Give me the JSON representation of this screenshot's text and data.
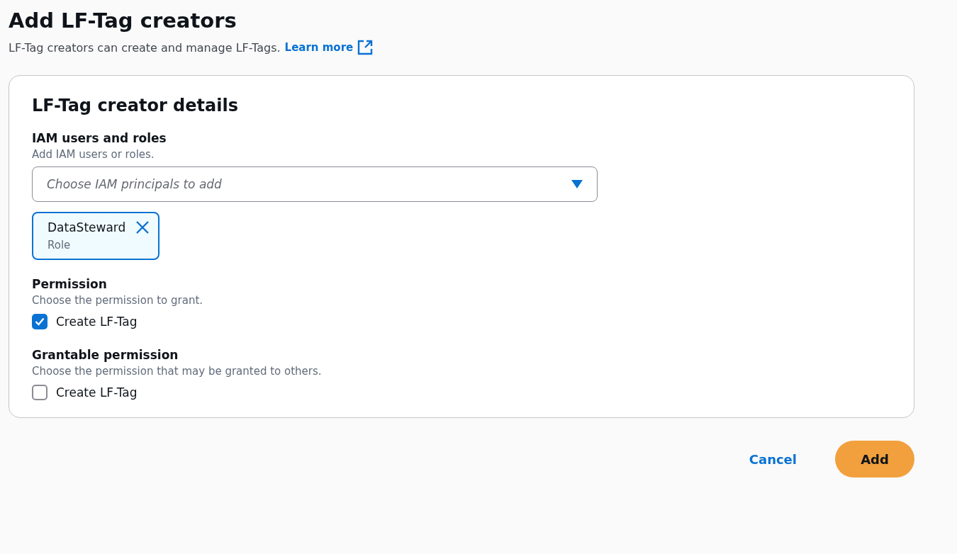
{
  "page": {
    "title": "Add LF-Tag creators",
    "description": "LF-Tag creators can create and manage LF-Tags.",
    "learn_more": "Learn more"
  },
  "panel": {
    "title": "LF-Tag creator details",
    "principals": {
      "label": "IAM users and roles",
      "hint": "Add IAM users or roles.",
      "placeholder": "Choose IAM principals to add",
      "tokens": [
        {
          "name": "DataSteward",
          "type": "Role"
        }
      ]
    },
    "sections": [
      {
        "label": "Permission",
        "hint": "Choose the permission to grant.",
        "option": {
          "label": "Create LF-Tag",
          "checked": true
        }
      },
      {
        "label": "Grantable permission",
        "hint": "Choose the permission that may be granted to others.",
        "option": {
          "label": "Create LF-Tag",
          "checked": false
        }
      }
    ]
  },
  "actions": {
    "cancel": "Cancel",
    "submit": "Add"
  }
}
